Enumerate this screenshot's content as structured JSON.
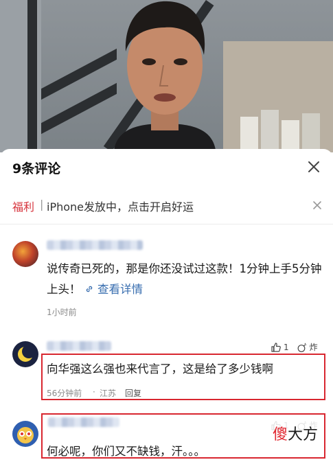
{
  "sheet": {
    "title": "9条评论"
  },
  "promo": {
    "tag": "福利",
    "separator": "|",
    "text": "iPhone发放中，点击开启好运"
  },
  "comments": [
    {
      "text": "说传奇已死的，那是你还没试过这款！1分钟上手5分钟上头！",
      "link_label": "查看详情",
      "time": "1小时前"
    },
    {
      "text": "向华强这么强也来代言了，这是给了多少钱啊",
      "time": "56分钟前",
      "location": "江苏",
      "reply_label": "回复",
      "likes": "1",
      "bomb_label": "炸"
    },
    {
      "text": "何必呢，你们又不缺钱，汗。。。",
      "likes": "1",
      "bomb_label": "炸"
    }
  ],
  "watermark": {
    "first": "傻",
    "rest": "大方"
  },
  "colors": {
    "accent_red": "#d6313a",
    "link_blue": "#3a6fb0",
    "highlight_box": "#d8262f"
  },
  "icons": [
    "close-icon",
    "link-icon",
    "thumbs-up-icon",
    "bomb-icon"
  ]
}
